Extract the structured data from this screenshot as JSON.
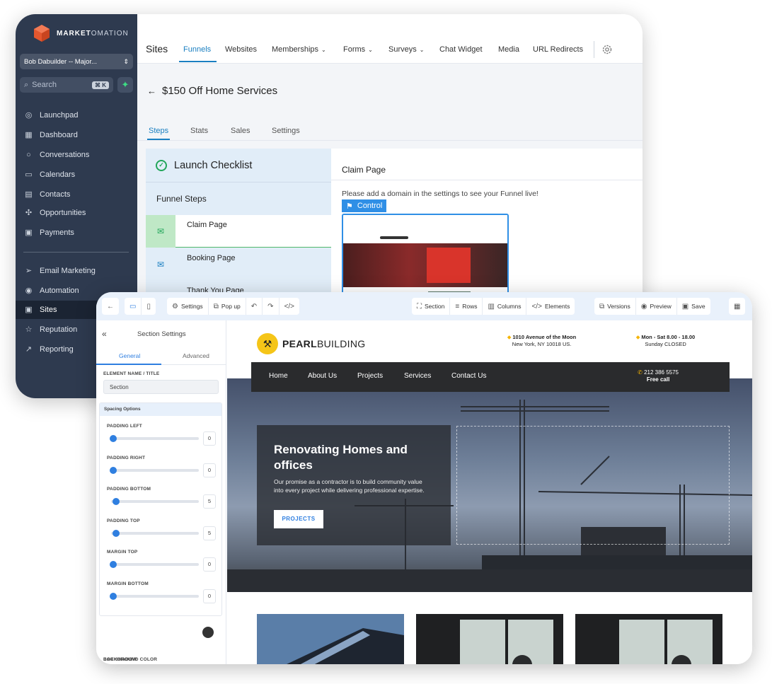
{
  "back_window": {
    "brand": {
      "name_bold": "MARKET",
      "name_rest": "OMATION"
    },
    "account": {
      "label": "Bob Dabuilder -- Major..."
    },
    "search": {
      "placeholder": "Search",
      "shortcut": "⌘ K"
    },
    "sidebar": {
      "items": [
        {
          "label": "Launchpad",
          "icon": "rocket-icon"
        },
        {
          "label": "Dashboard",
          "icon": "dashboard-icon"
        },
        {
          "label": "Conversations",
          "icon": "chat-icon"
        },
        {
          "label": "Calendars",
          "icon": "calendar-icon"
        },
        {
          "label": "Contacts",
          "icon": "contacts-icon"
        },
        {
          "label": "Opportunities",
          "icon": "opportunities-icon"
        },
        {
          "label": "Payments",
          "icon": "payments-icon"
        },
        {
          "label": "Email Marketing",
          "icon": "send-icon"
        },
        {
          "label": "Automation",
          "icon": "automation-icon"
        },
        {
          "label": "Sites",
          "icon": "sites-icon",
          "active": true
        },
        {
          "label": "Reputation",
          "icon": "star-icon"
        },
        {
          "label": "Reporting",
          "icon": "chart-icon"
        }
      ]
    },
    "topnav": {
      "title": "Sites",
      "tabs": [
        {
          "label": "Funnels",
          "active": true,
          "dropdown": false
        },
        {
          "label": "Websites",
          "dropdown": false
        },
        {
          "label": "Memberships",
          "dropdown": true
        },
        {
          "label": "Forms",
          "dropdown": true
        },
        {
          "label": "Surveys",
          "dropdown": true
        },
        {
          "label": "Chat Widget",
          "dropdown": false
        },
        {
          "label": "Media",
          "dropdown": false
        },
        {
          "label": "URL Redirects",
          "dropdown": false
        }
      ]
    },
    "funnel": {
      "title": "$150 Off Home Services",
      "subtabs": [
        "Steps",
        "Stats",
        "Sales",
        "Settings"
      ],
      "checklist_label": "Launch Checklist",
      "steps_heading": "Funnel Steps",
      "steps": [
        "Claim Page",
        "Booking Page",
        "Thank You Page"
      ],
      "page_title": "Claim Page",
      "domain_note": "Please add a domain in the settings to see your Funnel live!",
      "control_label": "Control"
    }
  },
  "front_window": {
    "toolbar": {
      "settings": "Settings",
      "popup": "Pop up",
      "section": "Section",
      "rows": "Rows",
      "columns": "Columns",
      "elements": "Elements",
      "versions": "Versions",
      "preview": "Preview",
      "save": "Save"
    },
    "panel": {
      "title": "Section Settings",
      "tab_general": "General",
      "tab_advanced": "Advanced",
      "element_name_label": "ELEMENT NAME / TITLE",
      "element_name_value": "Section",
      "spacing_heading": "Spacing Options",
      "spacing": [
        {
          "label": "PADDING LEFT",
          "value": "0"
        },
        {
          "label": "PADDING RIGHT",
          "value": "0"
        },
        {
          "label": "PADDING BOTTOM",
          "value": "5"
        },
        {
          "label": "PADDING TOP",
          "value": "5"
        },
        {
          "label": "MARGIN TOP",
          "value": "0"
        },
        {
          "label": "MARGIN BOTTOM",
          "value": "0"
        }
      ],
      "bg_color_label": "BACKGROUND COLOR",
      "box_shadow_label": "BOX SHADOW"
    },
    "site": {
      "logo_bold": "PEARL",
      "logo_rest": "BUILDING",
      "address_line1": "1010 Avenue of the Moon",
      "address_line2": "New York, NY 10018 US.",
      "hours_line1": "Mon - Sat 8.00 - 18.00",
      "hours_line2": "Sunday CLOSED",
      "nav": [
        "Home",
        "About Us",
        "Projects",
        "Services",
        "Contact Us"
      ],
      "phone": "212 386 5575",
      "phone_note": "Free call",
      "hero_heading": "Renovating Homes and offices",
      "hero_text": "Our promise as a contractor is to build community value into every project while delivering professional expertise.",
      "hero_button": "PROJECTS"
    }
  },
  "colors": {
    "sidebar_bg": "#2e3a4f",
    "accent_blue": "#1a7fc1",
    "builder_blue": "#2f7fe0",
    "brand_orange": "#e4572e",
    "site_yellow": "#f5c518"
  }
}
